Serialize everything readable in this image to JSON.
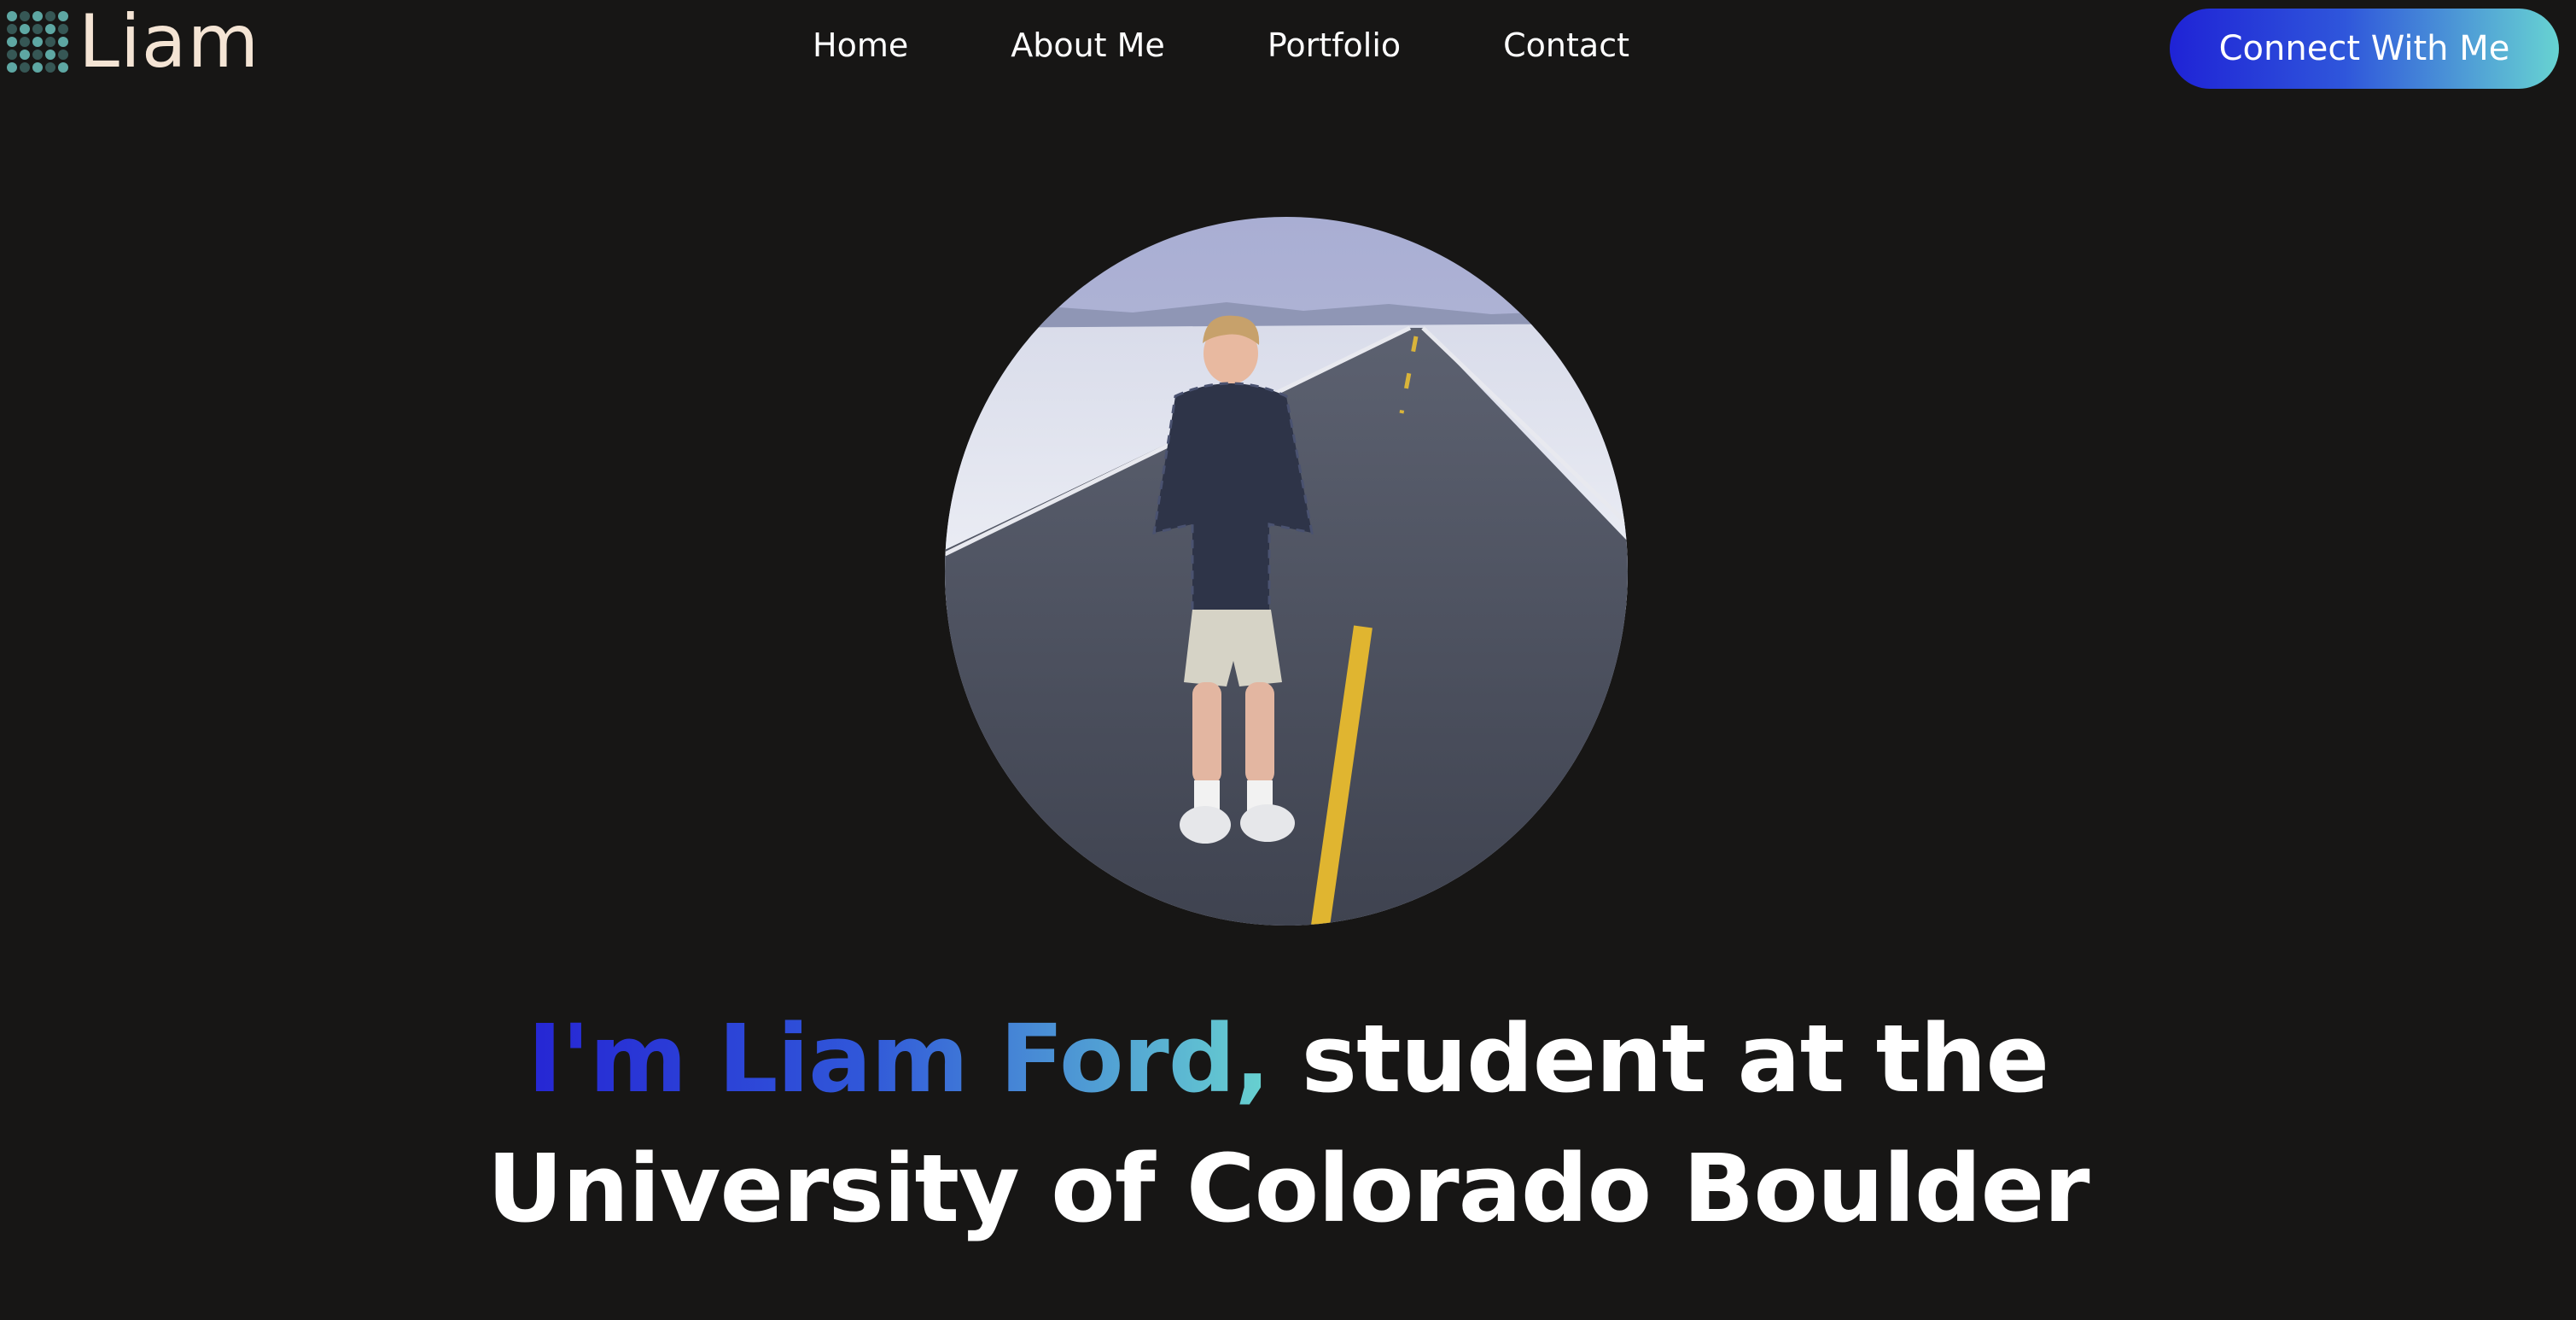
{
  "header": {
    "logo_text": "Liam",
    "nav": [
      {
        "label": "Home"
      },
      {
        "label": "About Me"
      },
      {
        "label": "Portfolio"
      },
      {
        "label": "Contact"
      }
    ],
    "cta_label": "Connect With Me"
  },
  "hero": {
    "headline_highlight": "I'm Liam Ford,",
    "headline_rest_line1": " student at the",
    "headline_line2": "University of Colorado Boulder"
  },
  "colors": {
    "background": "#171615",
    "logo_text": "#f4e4d4",
    "logo_dots": "#5ea7a3",
    "gradient_start": "#1f23d6",
    "gradient_end": "#67d3d2"
  }
}
